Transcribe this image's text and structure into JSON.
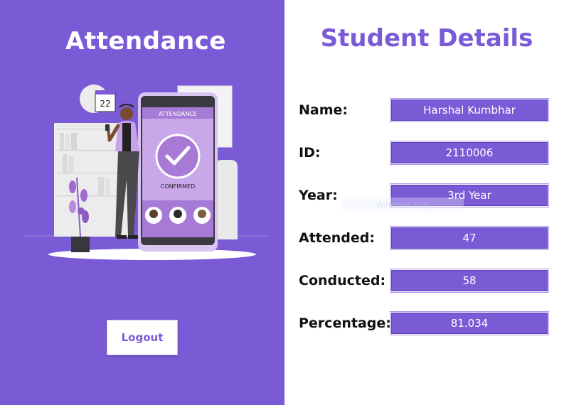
{
  "left_panel": {
    "title": "Attendance",
    "calendar_day": "22",
    "phone_header": "ATTENDANCE",
    "phone_status": "CONFIRMED",
    "logout_label": "Logout"
  },
  "right_panel": {
    "title": "Student Details",
    "fields": [
      {
        "label": "Name:",
        "value": "Harshal Kumbhar"
      },
      {
        "label": "ID:",
        "value": "2110006"
      },
      {
        "label": "Year:",
        "value": "3rd Year"
      },
      {
        "label": "Attended:",
        "value": "47"
      },
      {
        "label": "Conducted:",
        "value": "58"
      },
      {
        "label": "Percentage:",
        "value": "81.034"
      }
    ],
    "overlay_text": "Windows Snip"
  },
  "colors": {
    "primary": "#7b5ad6",
    "white": "#ffffff",
    "text_dark": "#111111"
  }
}
